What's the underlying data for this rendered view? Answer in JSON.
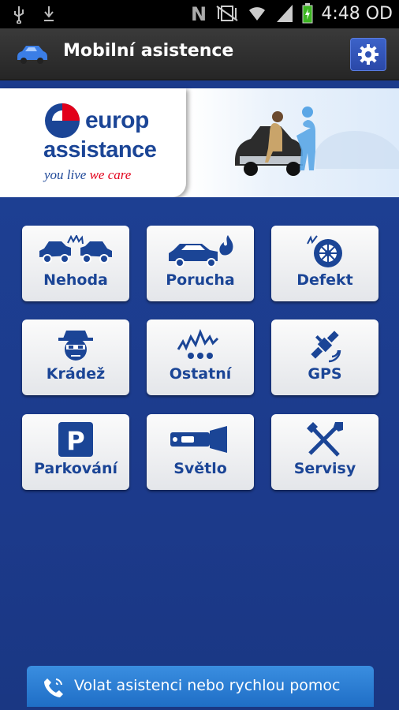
{
  "status_bar": {
    "time": "4:48 OD",
    "icons": [
      "usb-icon",
      "download-icon",
      "nfc-icon",
      "vibrate-off-icon",
      "wifi-icon",
      "signal-icon",
      "battery-charging-icon"
    ]
  },
  "action_bar": {
    "title": "Mobilní asistence",
    "app_icon": "car-icon",
    "settings_icon": "gear-icon"
  },
  "banner": {
    "logo_word1": "europ",
    "logo_word2": "assistance",
    "tagline_part1": "you live",
    "tagline_part2": "we care"
  },
  "tiles": [
    {
      "label": "Nehoda",
      "icon": "car-crash-icon"
    },
    {
      "label": "Porucha",
      "icon": "car-fire-icon"
    },
    {
      "label": "Defekt",
      "icon": "tire-icon"
    },
    {
      "label": "Krádež",
      "icon": "thief-icon"
    },
    {
      "label": "Ostatní",
      "icon": "other-icon"
    },
    {
      "label": "GPS",
      "icon": "satellite-icon"
    },
    {
      "label": "Parkování",
      "icon": "parking-icon"
    },
    {
      "label": "Světlo",
      "icon": "flashlight-icon"
    },
    {
      "label": "Servisy",
      "icon": "tools-icon"
    }
  ],
  "call_bar": {
    "label": "Volat asistenci nebo rychlou pomoc",
    "icon": "phone-icon"
  },
  "colors": {
    "brand_blue": "#1b4596",
    "background_blue": "#1d3f92",
    "accent_red": "#e2001a",
    "call_blue": "#2a7ed4"
  }
}
